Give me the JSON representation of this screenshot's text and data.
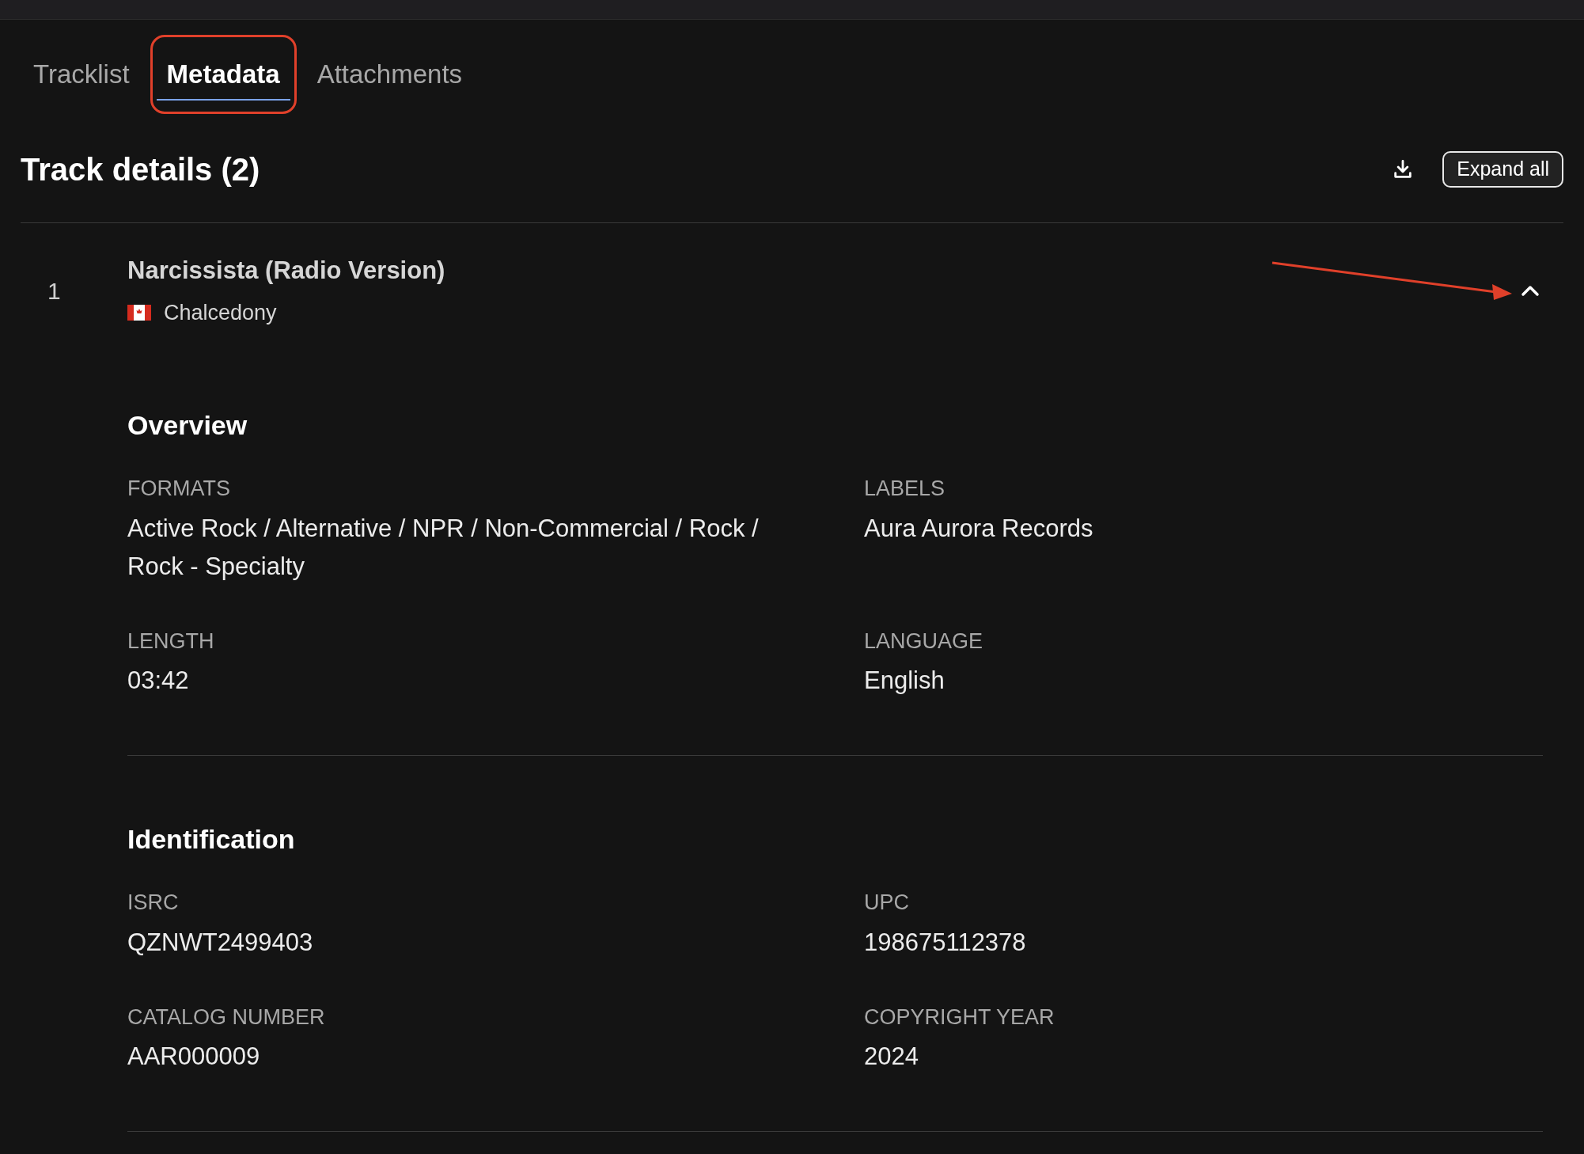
{
  "tabs": [
    {
      "label": "Tracklist",
      "selected": false,
      "highlighted": false
    },
    {
      "label": "Metadata",
      "selected": true,
      "highlighted": true
    },
    {
      "label": "Attachments",
      "selected": false,
      "highlighted": false
    }
  ],
  "header": {
    "title": "Track details (2)",
    "expand_button": "Expand all"
  },
  "tracks": [
    {
      "number": "1",
      "title": "Narcissista (Radio Version)",
      "artist": "Chalcedony",
      "expanded": true,
      "annotated": true,
      "sections": [
        {
          "title": "Overview",
          "fields": [
            {
              "label": "FORMATS",
              "value": "Active Rock / Alternative / NPR / Non-Commercial / Rock / Rock - Specialty"
            },
            {
              "label": "LABELS",
              "value": "Aura Aurora Records"
            },
            {
              "label": "LENGTH",
              "value": "03:42"
            },
            {
              "label": "LANGUAGE",
              "value": "English"
            }
          ]
        },
        {
          "title": "Identification",
          "fields": [
            {
              "label": "ISRC",
              "value": "QZNWT2499403"
            },
            {
              "label": "UPC",
              "value": "198675112378"
            },
            {
              "label": "CATALOG NUMBER",
              "value": "AAR000009"
            },
            {
              "label": "COPYRIGHT YEAR",
              "value": "2024"
            }
          ]
        }
      ]
    }
  ]
}
